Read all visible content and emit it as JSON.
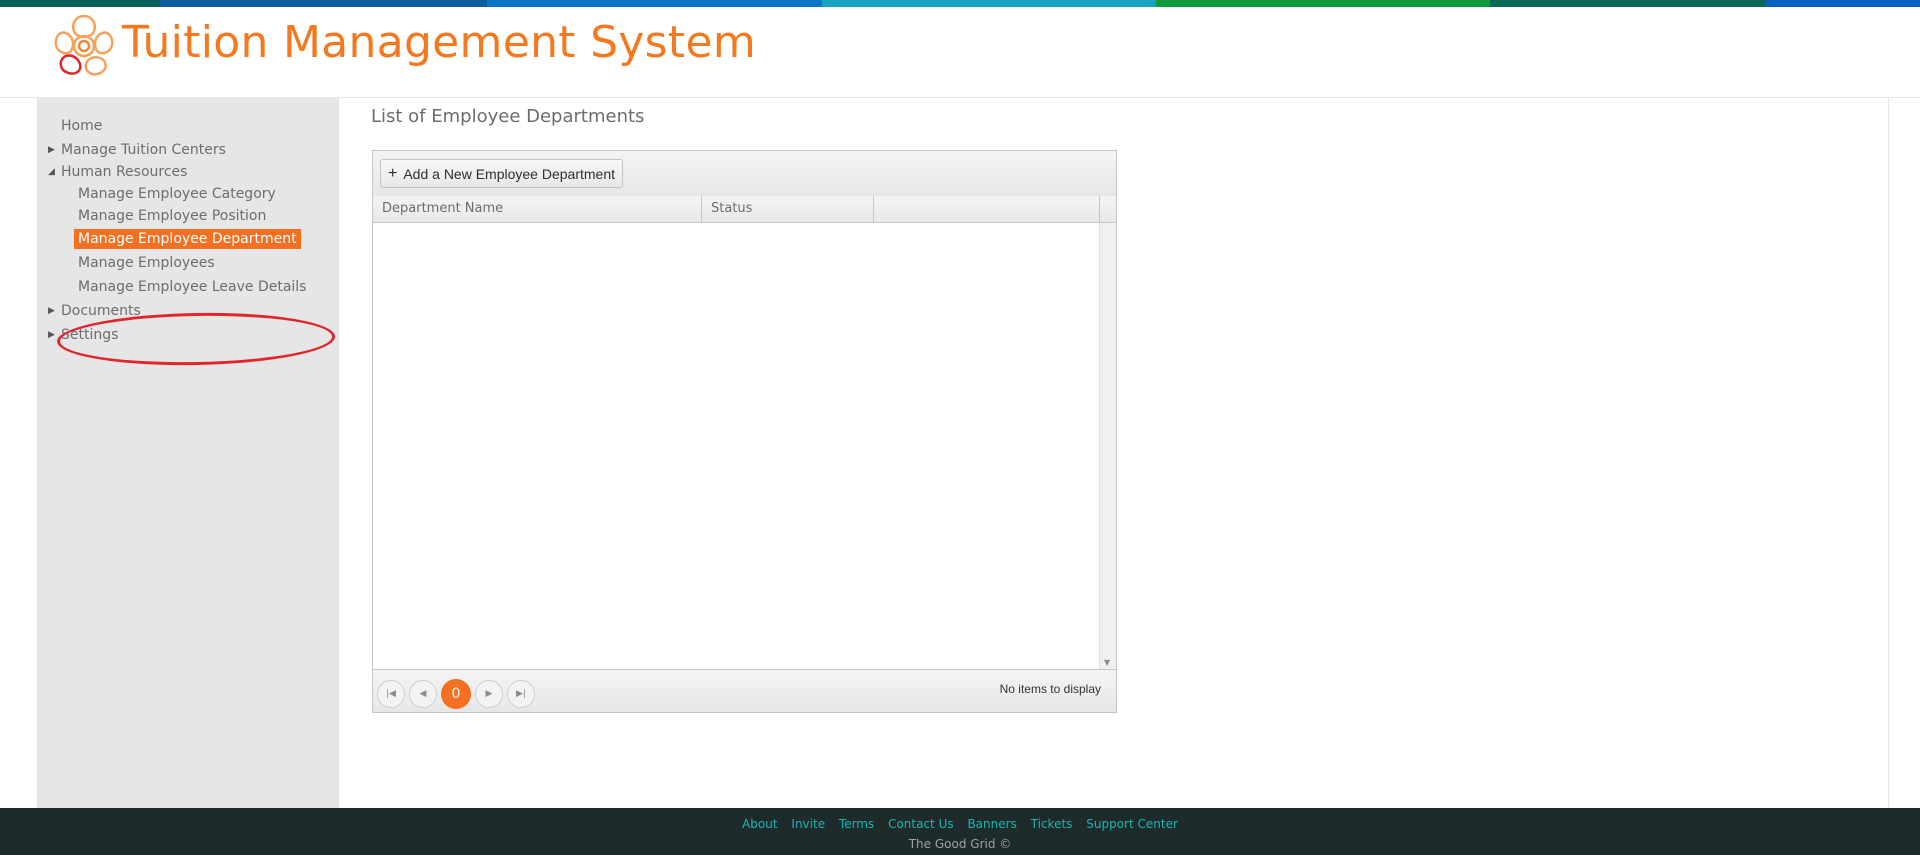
{
  "app": {
    "title": "Tuition Management System"
  },
  "colors": {
    "accent": "#f36f21",
    "title": "#f5781e",
    "highlight_ring": "#e0262a",
    "footer_bg": "#1f2a2a",
    "footer_link": "#19b7b1"
  },
  "topbar_colors": [
    "#0b5f5a",
    "#0b5f9e",
    "#0a75c7",
    "#15a3c0",
    "#0f9a3f",
    "#0a6a57",
    "#0a4a6a",
    "#0a62c0"
  ],
  "sidebar": {
    "items": [
      {
        "label": "Home",
        "expandable": false
      },
      {
        "label": "Manage Tuition Centers",
        "expandable": true,
        "expanded": false
      },
      {
        "label": "Human Resources",
        "expandable": true,
        "expanded": true,
        "children": [
          {
            "label": "Manage Employee Category"
          },
          {
            "label": "Manage Employee Position"
          },
          {
            "label": "Manage Employee Department",
            "active": true
          },
          {
            "label": "Manage Employees"
          },
          {
            "label": "Manage Employee Leave Details"
          }
        ]
      },
      {
        "label": "Documents",
        "expandable": true,
        "expanded": false
      },
      {
        "label": "Settings",
        "expandable": true,
        "expanded": false
      }
    ]
  },
  "main": {
    "heading": "List of Employee Departments",
    "add_button_label": "Add a New Employee Department",
    "columns": [
      "Department Name",
      "Status",
      ""
    ],
    "pager": {
      "current_page": "0",
      "info": "No items to display"
    }
  },
  "footer": {
    "links": [
      "About",
      "Invite",
      "Terms",
      "Contact Us",
      "Banners",
      "Tickets",
      "Support Center"
    ],
    "copyright": "The Good Grid ©"
  }
}
